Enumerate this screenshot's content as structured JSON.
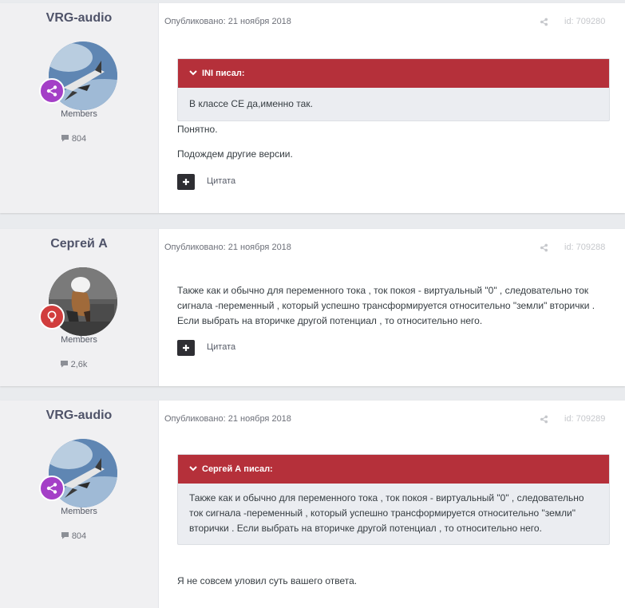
{
  "posts": [
    {
      "author": "VRG-audio",
      "group": "Members",
      "count": "804",
      "published": "Опубликовано: 21 ноября 2018",
      "id": "id: 709280",
      "quote": {
        "header": "INI писал:",
        "text": "В классе СЕ да,именно так."
      },
      "paragraphs": [
        "Понятно.",
        "Подождем другие версии."
      ],
      "cite_label": "Цитата"
    },
    {
      "author": "Сергей А",
      "group": "Members",
      "count": "2,6k",
      "published": "Опубликовано: 21 ноября 2018",
      "id": "id: 709288",
      "paragraphs": [
        "Также как и обычно для переменного тока , ток покоя - виртуальный \"0\" , следовательно ток сигнала -переменный , который успешно трансформируется относительно \"земли\" вторички . Если выбрать на вторичке другой потенциал , то относительно него."
      ],
      "cite_label": "Цитата"
    },
    {
      "author": "VRG-audio",
      "group": "Members",
      "count": "804",
      "published": "Опубликовано: 21 ноября 2018",
      "id": "id: 709289",
      "quote": {
        "header": "Сергей А писал:",
        "text": "Также как и обычно для переменного тока , ток покоя - виртуальный \"0\" , следовательно ток сигнала -переменный , который успешно трансформируется относительно \"земли\" вторички . Если выбрать на вторичке другой потенциал , то относительно него."
      },
      "paragraphs": [
        "Я не совсем уловил суть вашего ответа."
      ]
    }
  ],
  "icons": {
    "share": "share-icon",
    "count": "speech-bubble-icon",
    "badge_vrg": "share-nodes-icon",
    "badge_sergey": "lightbulb-icon",
    "plus": "plus-icon",
    "quote_toggle": "chevron-down-icon"
  },
  "colors": {
    "quote_header": "#b5303a",
    "badge_vrg": "#a43fc7",
    "badge_sergey": "#d13d3d",
    "sidebar_bg": "#f0f0f2",
    "page_bg": "#e9ebee"
  }
}
